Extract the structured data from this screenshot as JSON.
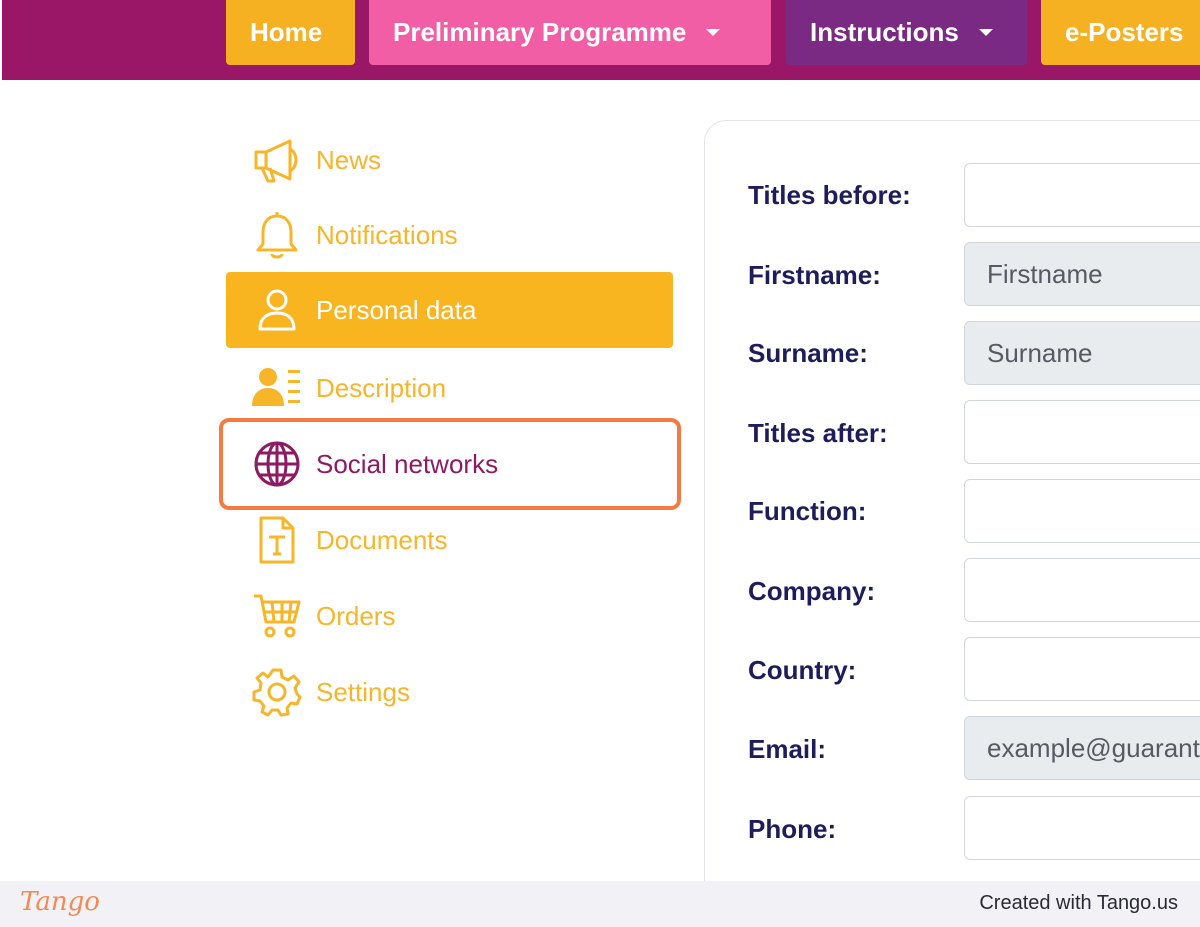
{
  "nav": {
    "home": "Home",
    "programme": "Preliminary Programme",
    "instructions": "Instructions",
    "eposters": "e-Posters"
  },
  "sidebar": {
    "items": [
      {
        "label": "News",
        "icon": "megaphone-icon"
      },
      {
        "label": "Notifications",
        "icon": "bell-icon"
      },
      {
        "label": "Personal data",
        "icon": "user-icon",
        "active": true
      },
      {
        "label": "Description",
        "icon": "user-list-icon"
      },
      {
        "label": "Social networks",
        "icon": "globe-icon",
        "highlighted": true
      },
      {
        "label": "Documents",
        "icon": "document-icon"
      },
      {
        "label": "Orders",
        "icon": "cart-icon"
      },
      {
        "label": "Settings",
        "icon": "gear-icon"
      }
    ]
  },
  "form": {
    "fields": [
      {
        "label": "Titles before:",
        "value": ""
      },
      {
        "label": "Firstname:",
        "value": "Firstname",
        "readonly": true
      },
      {
        "label": "Surname:",
        "value": "Surname",
        "readonly": true
      },
      {
        "label": "Titles after:",
        "value": ""
      },
      {
        "label": "Function:",
        "value": ""
      },
      {
        "label": "Company:",
        "value": ""
      },
      {
        "label": "Country:",
        "value": ""
      },
      {
        "label": "Email:",
        "value": "example@guarantee.com",
        "readonly": true
      },
      {
        "label": "Phone:",
        "value": ""
      }
    ]
  },
  "footer": {
    "logo": "Tango",
    "credit": "Created with Tango.us"
  },
  "colors": {
    "brand_purple": "#9a1667",
    "accent_yellow": "#f8b51f",
    "pink": "#f25ea5",
    "violet": "#7b2a83",
    "highlight_orange": "#f47a44",
    "label_navy": "#1f1c5c"
  }
}
